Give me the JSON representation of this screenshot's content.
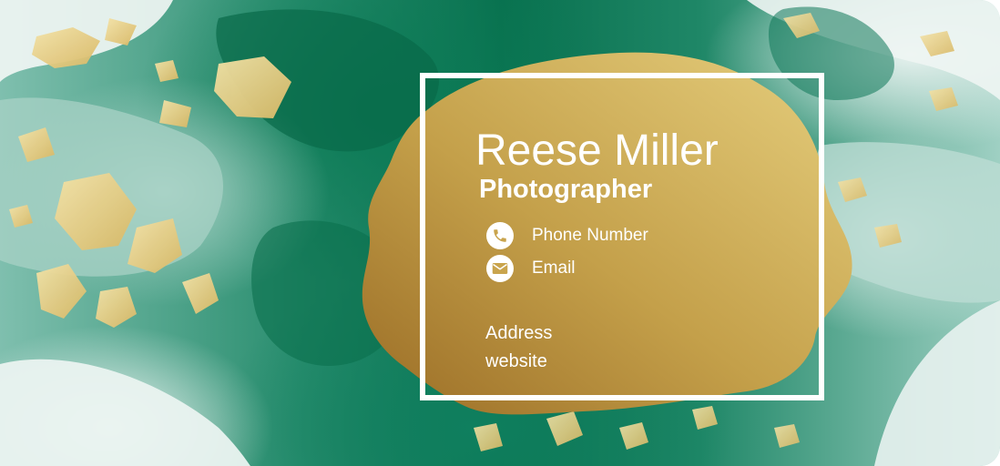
{
  "card": {
    "name": "Reese Miller",
    "title": "Photographer",
    "contacts": [
      {
        "icon": "phone-icon",
        "label": "Phone Number"
      },
      {
        "icon": "email-icon",
        "label": "Email"
      }
    ],
    "address": "Address",
    "website": "website"
  },
  "colors": {
    "emerald": "#0b7a55",
    "mint": "#cfe6df",
    "gold_light": "#e6cf7e",
    "gold_dark": "#9a6c25",
    "text": "#ffffff"
  }
}
